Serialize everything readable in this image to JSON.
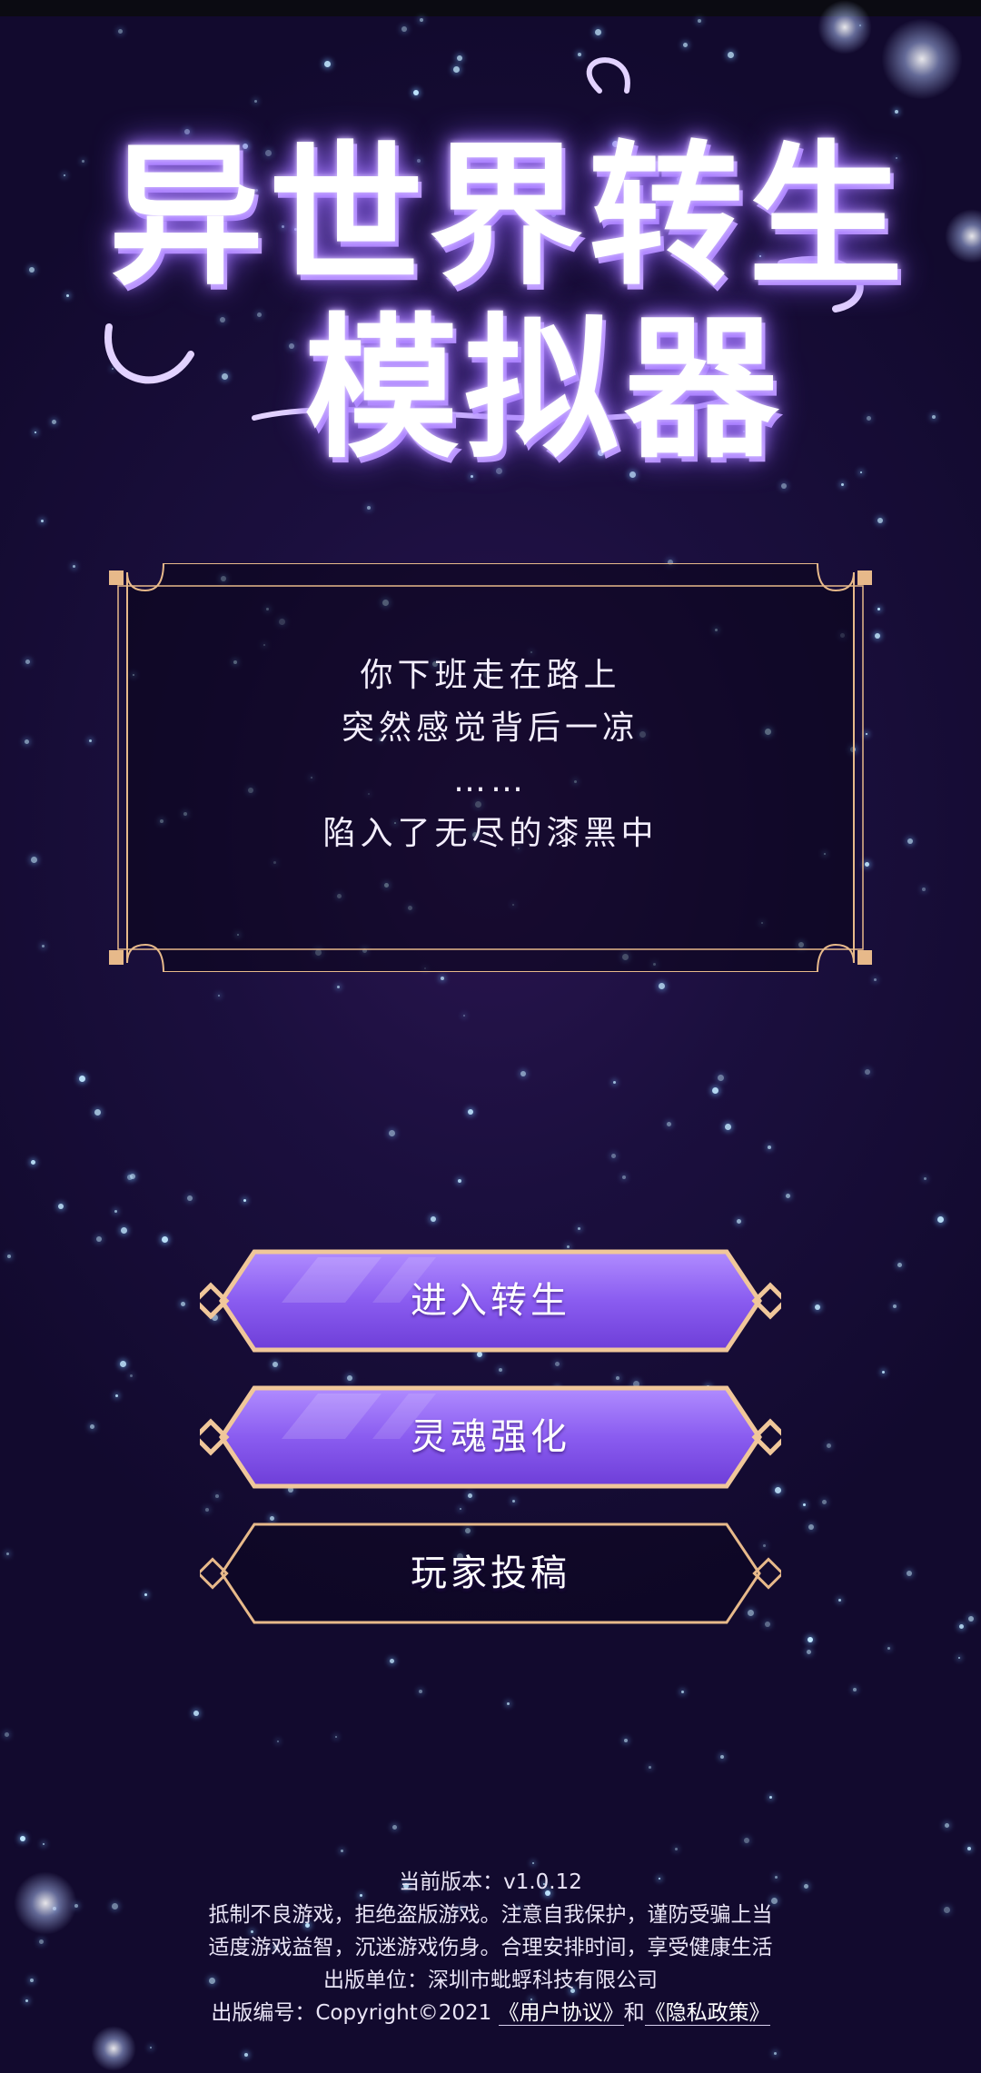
{
  "logo": {
    "line1": "异世界转生",
    "line2": "模拟器"
  },
  "story": {
    "lines": [
      "你下班走在路上",
      "突然感觉背后一凉",
      "……",
      "陷入了无尽的漆黑中"
    ]
  },
  "buttons": {
    "enter": "进入转生",
    "soul": "灵魂强化",
    "submit": "玩家投稿"
  },
  "footer": {
    "version": "当前版本：v1.0.12",
    "notice1": "抵制不良游戏，拒绝盗版游戏。注意自我保护，谨防受骗上当",
    "notice2": "适度游戏益智，沉迷游戏伤身。合理安排时间，享受健康生活",
    "publisher": "出版单位：深圳市蚍蜉科技有限公司",
    "pub_no_prefix": "出版编号：Copyright©2021 ",
    "user_agreement": "《用户协议》",
    "and": "和",
    "privacy_policy": "《隐私政策》"
  },
  "colors": {
    "background": "#120a2e",
    "frame_gold": "#e7b98a",
    "button_purple": "#8a5cf0",
    "star": "#bfe6ff"
  }
}
